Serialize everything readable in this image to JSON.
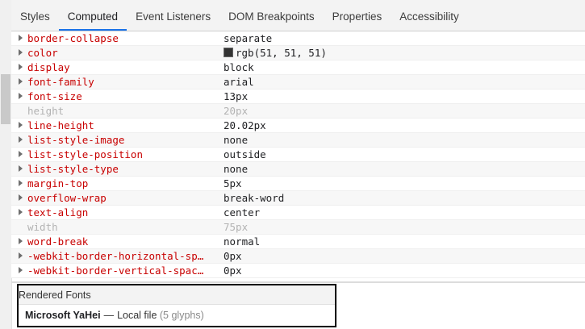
{
  "tabs": [
    {
      "label": "Styles"
    },
    {
      "label": "Computed"
    },
    {
      "label": "Event Listeners"
    },
    {
      "label": "DOM Breakpoints"
    },
    {
      "label": "Properties"
    },
    {
      "label": "Accessibility"
    }
  ],
  "active_tab": "Computed",
  "properties": [
    {
      "name": "border-collapse",
      "value": "separate"
    },
    {
      "name": "color",
      "value": "rgb(51, 51, 51)"
    },
    {
      "name": "display",
      "value": "block"
    },
    {
      "name": "font-family",
      "value": "arial"
    },
    {
      "name": "font-size",
      "value": "13px"
    },
    {
      "name": "height",
      "value": "20px"
    },
    {
      "name": "line-height",
      "value": "20.02px"
    },
    {
      "name": "list-style-image",
      "value": "none"
    },
    {
      "name": "list-style-position",
      "value": "outside"
    },
    {
      "name": "list-style-type",
      "value": "none"
    },
    {
      "name": "margin-top",
      "value": "5px"
    },
    {
      "name": "overflow-wrap",
      "value": "break-word"
    },
    {
      "name": "text-align",
      "value": "center"
    },
    {
      "name": "width",
      "value": "75px"
    },
    {
      "name": "word-break",
      "value": "normal"
    },
    {
      "name": "-webkit-border-horizontal-sp…",
      "value": "0px"
    },
    {
      "name": "-webkit-border-vertical-spac…",
      "value": "0px"
    }
  ],
  "rendered_fonts": {
    "header": "Rendered Fonts",
    "font_name": "Microsoft YaHei",
    "dash": "—",
    "source": "Local file",
    "glyphs": "(5 glyphs)"
  },
  "colors": {
    "property_name": "#c80000",
    "color_swatch": "#333333",
    "active_tab_underline": "#1a73e8"
  }
}
